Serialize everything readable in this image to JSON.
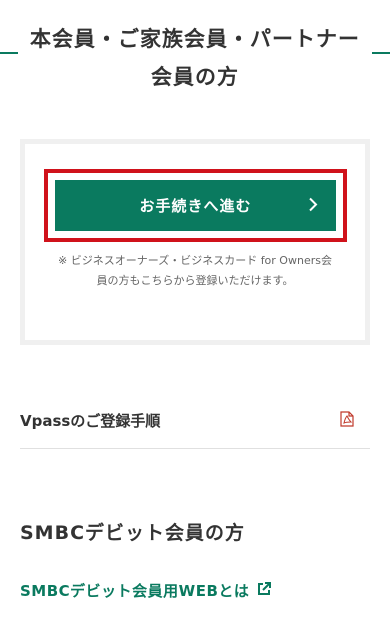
{
  "header": {
    "title": "本会員・ご家族会員・パートナー会員の方"
  },
  "card": {
    "cta_label": "お手続きへ進む",
    "note": "※ ビジネスオーナーズ・ビジネスカード for Owners会員の方もこちらから登録いただけます。"
  },
  "vpass": {
    "label": "Vpassのご登録手順"
  },
  "debit": {
    "section_title": "SMBCデビット会員の方",
    "link_label": "SMBCデビット会員用WEBとは"
  },
  "colors": {
    "brand_green": "#0a7a5f",
    "highlight_red": "#d0121b"
  },
  "icons": {
    "cta_chevron": "chevron-right-icon",
    "pdf": "pdf-icon",
    "external": "external-link-icon"
  }
}
